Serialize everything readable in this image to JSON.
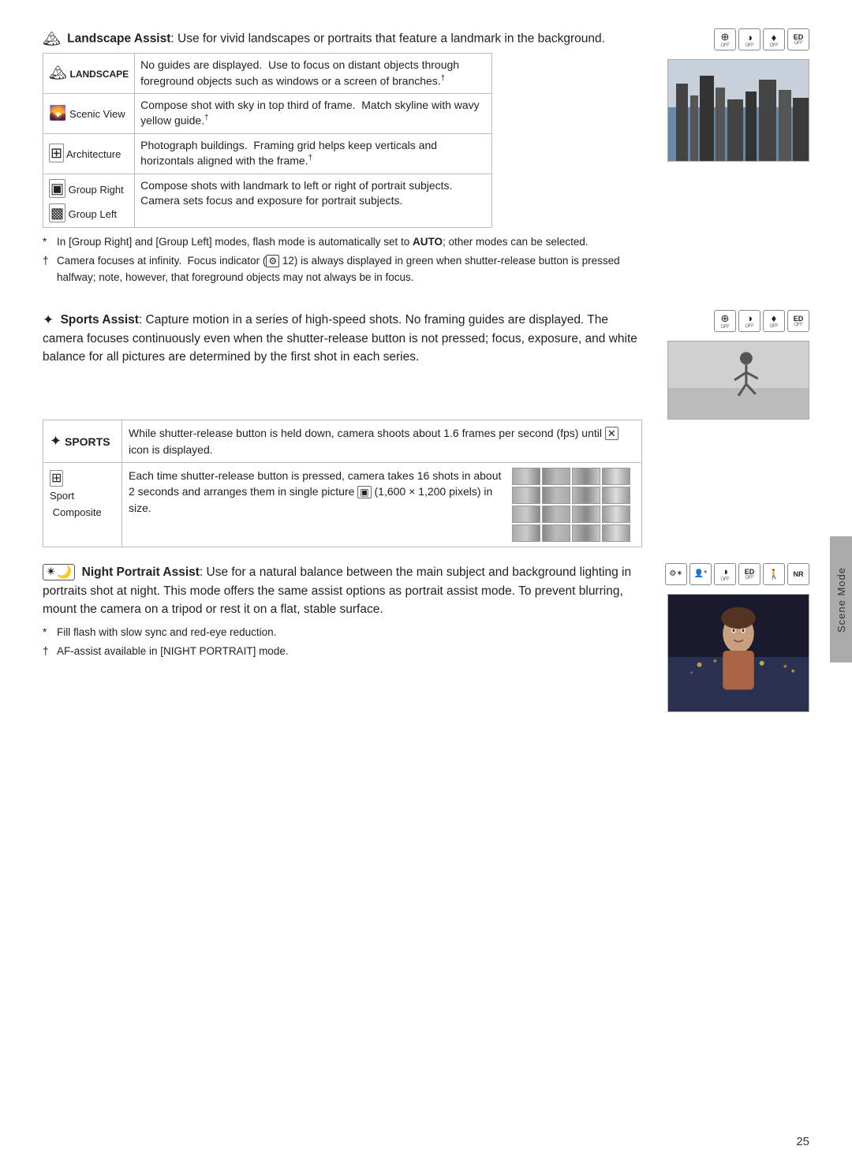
{
  "page": {
    "number": "25",
    "side_tab": "Scene Mode"
  },
  "landscape_section": {
    "icon": "🏔",
    "title_prefix": "Landscape Assist",
    "title_text": ": Use for vivid landscapes or portraits that feature a landmark in the background.",
    "icons_strip": [
      {
        "symbol": "⊕",
        "sub": "OFF"
      },
      {
        "symbol": "◑",
        "sub": "OFF"
      },
      {
        "symbol": "▼",
        "sub": "OFF"
      },
      {
        "symbol": "ED",
        "sub": "OFF"
      }
    ],
    "table": {
      "rows": [
        {
          "icon": "🏔",
          "label": "LANDSCAPE",
          "desc": "No guides are displayed.  Use to focus on distant objects through foreground objects such as windows or a screen of branches.†"
        },
        {
          "icon": "🌄",
          "label": "Scenic View",
          "desc": "Compose shot with sky in top third of frame.  Match skyline with wavy yellow guide.†"
        },
        {
          "icon": "⊞",
          "label": "Architecture",
          "desc": "Photograph buildings.  Framing grid helps keep verticals and horizontals aligned with the frame.†"
        },
        {
          "icon": "▣",
          "label": "Group Right",
          "desc": "Compose shots with landmark to left or right of portrait subjects.  Camera sets focus and exposure for portrait subjects."
        },
        {
          "icon": "▩",
          "label": "Group Left",
          "desc": ""
        }
      ]
    },
    "notes": [
      "* In [Group Right] and [Group Left] modes, flash mode is automatically set to AUTO; other modes can be selected.",
      "† Camera focuses at infinity.  Focus indicator ( 12) is always displayed in green when shutter-release button is pressed halfway; note, however, that foreground objects may not always be in focus."
    ]
  },
  "sports_section": {
    "icon": "⚡",
    "title_prefix": "Sports Assist",
    "title_text": ": Capture motion in a series of high-speed shots. No framing guides are displayed.  The camera focuses continuously even when the shutter-release button is not pressed; focus, exposure, and white balance for all pictures are determined by the first shot in each series.",
    "icons_strip": [
      {
        "symbol": "⊕",
        "sub": "OFF"
      },
      {
        "symbol": "◑",
        "sub": "OFF"
      },
      {
        "symbol": "▼",
        "sub": "OFF"
      },
      {
        "symbol": "ED",
        "sub": "OFF"
      }
    ],
    "table": {
      "rows": [
        {
          "icon": "⚡",
          "label": "SPORTS",
          "desc": "While shutter-release button is held down, camera shoots about 1.6 frames per second (fps) until  icon is displayed."
        },
        {
          "icon": "⊞",
          "label": "Sport Composite",
          "desc": "Each time shutter-release button is pressed, camera takes 16 shots in about 2 seconds and arranges them in single picture  (1,600 × 1,200 pixels) in size."
        }
      ]
    }
  },
  "night_section": {
    "icon": "✴",
    "title_prefix": "Night Portrait Assist",
    "title_text": ": Use for a natural balance between the main subject and background lighting in portraits shot at night.  This mode offers the same assist options as portrait assist mode.  To prevent blurring, mount the camera on a tripod or rest it on a flat, stable surface.",
    "notes": [
      "* Fill flash with slow sync and red-eye reduction.",
      "† AF-assist available in [NIGHT PORTRAIT] mode."
    ]
  }
}
